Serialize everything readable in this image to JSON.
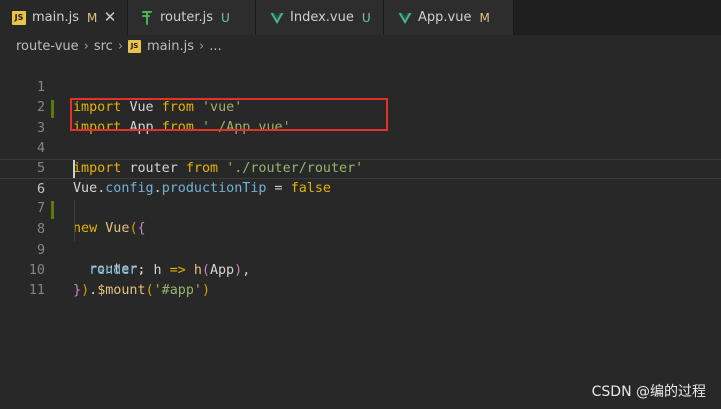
{
  "tabs": [
    {
      "label": "main.js",
      "status": "M",
      "icon": "js-file-icon",
      "active": true,
      "close": "✕"
    },
    {
      "label": "router.js",
      "status": "U",
      "icon": "router-file-icon",
      "active": false
    },
    {
      "label": "Index.vue",
      "status": "U",
      "icon": "vue-file-icon",
      "active": false
    },
    {
      "label": "App.vue",
      "status": "M",
      "icon": "vue-file-icon",
      "active": false
    }
  ],
  "breadcrumb": {
    "folder1": "route-vue",
    "folder2": "src",
    "file": "main.js",
    "more": "...",
    "separator": "›"
  },
  "editor": {
    "line_numbers": [
      "1",
      "2",
      "3",
      "4",
      "5",
      "6",
      "7",
      "8",
      "9",
      "10",
      "11"
    ],
    "current_line": "6",
    "modified_lines": [
      "3",
      "8"
    ],
    "tokens": {
      "import": "import",
      "from": "from",
      "vue_id": "Vue",
      "app_id": "App",
      "router_id": "router",
      "str_vue": "'vue'",
      "str_app": "'./App.vue'",
      "str_router": "'./router/router'",
      "config": "config",
      "productionTip": "productionTip",
      "eq": " = ",
      "false_kw": "false",
      "new_kw": "new",
      "render": "render",
      "h": "h",
      "arrow": "=>",
      "mount": "$mount",
      "str_app_sel": "'#app'"
    }
  },
  "watermark": "CSDN @编的过程",
  "colors": {
    "highlight_box": "#e3312c",
    "modified_status": "#e0c184",
    "untracked_status": "#73c991",
    "git_modified_bar": "#587c0c"
  }
}
